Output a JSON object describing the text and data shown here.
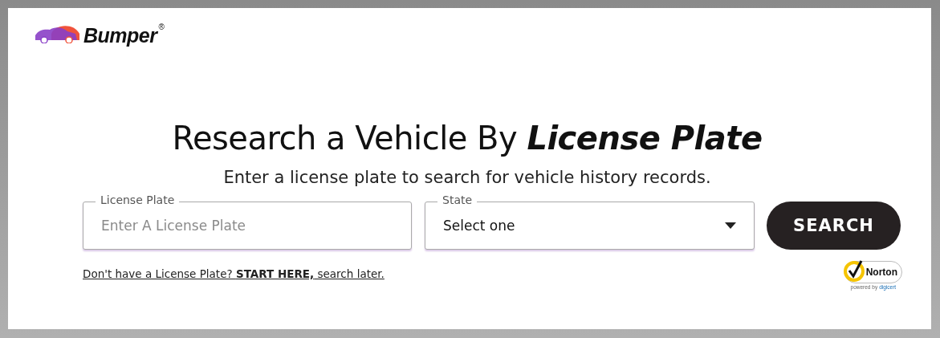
{
  "logo": {
    "name": "Bumper",
    "mark": "®"
  },
  "heading": "Research a Vehicle By **License Plate**",
  "subheading": "Enter a license plate to search for vehicle history records.",
  "form": {
    "plate": {
      "label": "License Plate",
      "placeholder": "Enter A License Plate"
    },
    "state": {
      "label": "State",
      "value": "Select one"
    },
    "button": "SEARCH"
  },
  "link": "Don't have a License Plate? **START HERE,** search later.",
  "seal": {
    "name": "Norton",
    "powered_by": "powered by",
    "brand": "digicert"
  }
}
